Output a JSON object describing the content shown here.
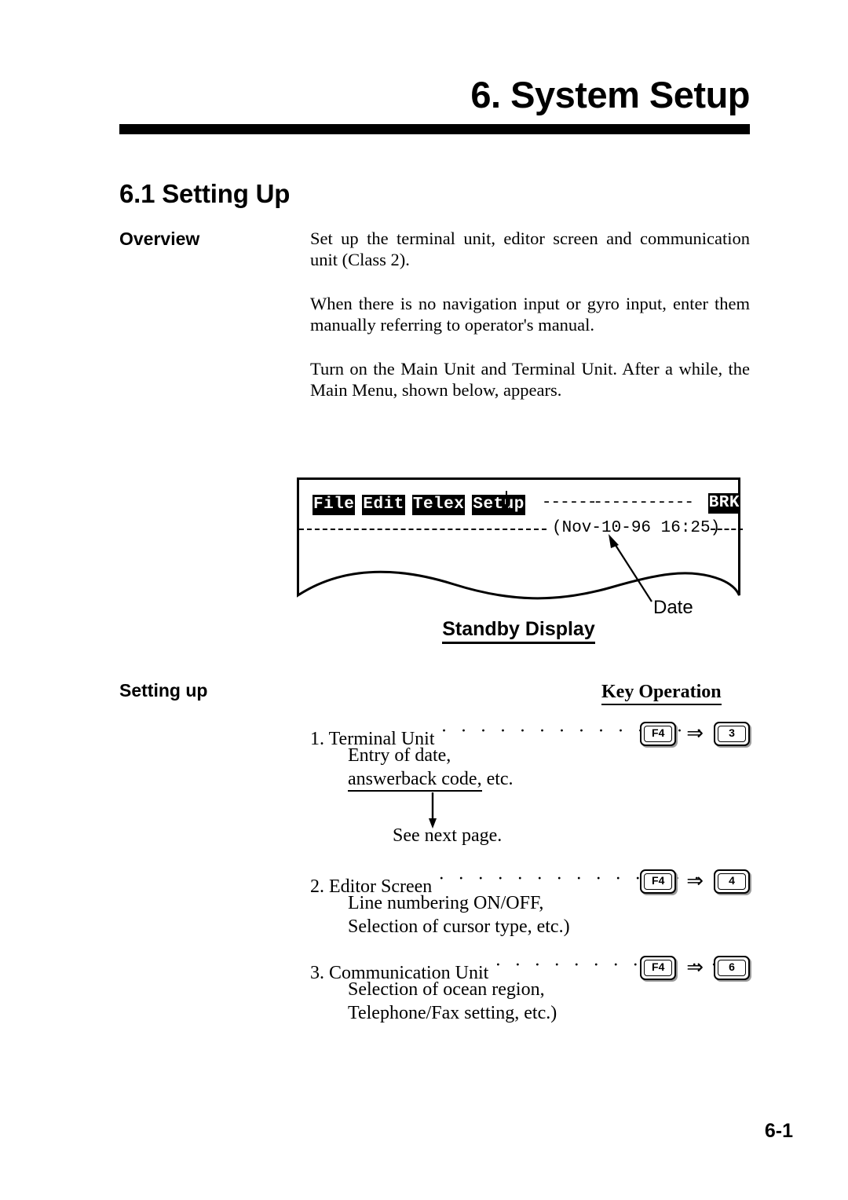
{
  "chapter": {
    "title": "6. System Setup",
    "section_title": "6.1 Setting Up"
  },
  "overview": {
    "label": "Overview",
    "paragraphs": [
      "Set up the terminal unit, editor screen and communication unit (Class 2).",
      "When there is no  navigation input or gyro input, enter them manually referring to operator's manual.",
      "Turn on the Main Unit and Terminal Unit. After a while, the Main Menu, shown below, appears."
    ]
  },
  "standby_display": {
    "caption": "Standby Display",
    "menu_items": [
      "File",
      "Edit",
      "Telex",
      "Setup"
    ],
    "menu_dash_left": "------",
    "menu_dash_right": "-----------",
    "brk_label": "BRK",
    "date_text": "(Nov-10-96 16:25)",
    "callout_label": "Date",
    "pointer_target": "Setup"
  },
  "setting_up": {
    "label": "Setting up",
    "key_operation_heading": "Key Operation",
    "key_arrow": "⇒",
    "leader_dots": "· · · · · · · · · · · · · · · ·",
    "steps": [
      {
        "title": "1. Terminal Unit",
        "leader": "· · · · · · · · · · · · · · · ·",
        "keys": [
          "F4",
          "3"
        ],
        "sub_lines": [
          "Entry of date,",
          "answerback code, etc."
        ],
        "underlined_part": "answerback code,",
        "underline_tail": " etc.",
        "next_note": "See next page."
      },
      {
        "title": "2. Editor Screen",
        "leader": "· · · · · · · · · · · · · · · ·",
        "keys": [
          "F4",
          "4"
        ],
        "sub_lines": [
          "Line numbering ON/OFF,",
          "Selection of cursor type, etc.)"
        ]
      },
      {
        "title": "3. Communication Unit",
        "leader": "· · · · · · · · · · · ·",
        "keys": [
          "F4",
          "6"
        ],
        "sub_lines": [
          "Selection of ocean region,",
          "Telephone/Fax setting, etc.)"
        ]
      }
    ]
  },
  "footer": {
    "page_number": "6-1"
  }
}
